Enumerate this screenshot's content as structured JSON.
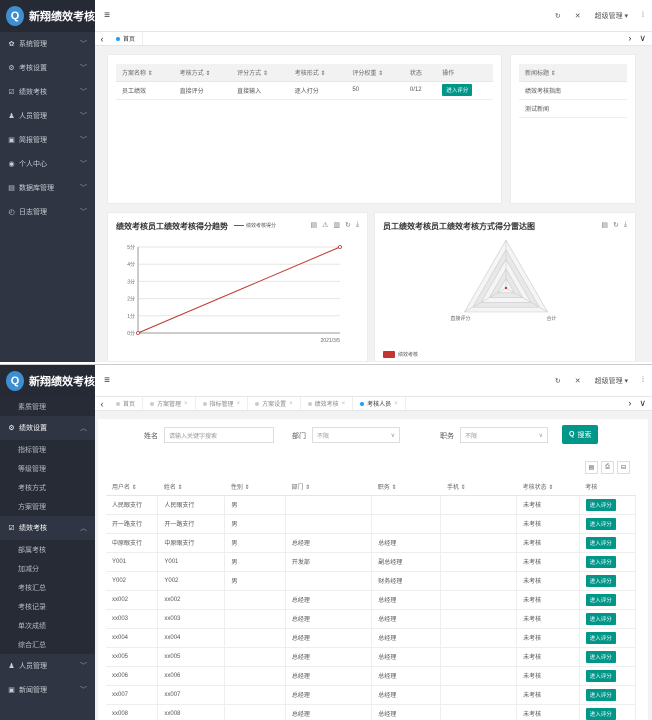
{
  "app": {
    "name": "新翔绩效考核",
    "logo": "Q"
  },
  "topbar": {
    "menu_icon": "≡",
    "refresh_icon": "↻",
    "fullscreen_icon": "✕",
    "user": "超级管理",
    "user_caret": "▾",
    "more": "⁞"
  },
  "nav_arrows": {
    "left": "‹",
    "right": "›",
    "down": "∨"
  },
  "shot1": {
    "sidebar": [
      {
        "icon": "✿",
        "label": "系统管理"
      },
      {
        "icon": "⚙",
        "label": "考核设置"
      },
      {
        "icon": "☑",
        "label": "绩效考核"
      },
      {
        "icon": "♟",
        "label": "人员管理"
      },
      {
        "icon": "▣",
        "label": "简报管理"
      },
      {
        "icon": "◉",
        "label": "个人中心"
      },
      {
        "icon": "▤",
        "label": "数据库管理"
      },
      {
        "icon": "◴",
        "label": "日志管理"
      }
    ],
    "tabs": [
      {
        "label": "首页"
      }
    ],
    "plan_table": {
      "headers": [
        "方案名称",
        "考核方式",
        "评分方式",
        "考核形式",
        "评分权重",
        "状态",
        "操作"
      ],
      "rows": [
        [
          "员工绩效",
          "直接评分",
          "直接输入",
          "逐人打分",
          "50",
          "0/12",
          "进入评分"
        ]
      ]
    },
    "news": {
      "header": "新闻标题",
      "items": [
        "绩效考核指南",
        "测试新闻"
      ]
    },
    "line_chart_title": "绩效考核员工绩效考核得分趋势",
    "line_chart_legend": "绩效考核得分",
    "radar_chart_title": "员工绩效考核员工绩效考核方式得分雷达图",
    "radar_labels": [
      "直接评分",
      "合计"
    ],
    "radar_legend": "绩效考核",
    "chart_tools": [
      "▤",
      "⚠",
      "▥",
      "↻",
      "⤓"
    ],
    "chart_tools2": [
      "▤",
      "↻",
      "⤓"
    ]
  },
  "chart_data": [
    {
      "type": "line",
      "title": "绩效考核员工绩效考核得分趋势",
      "x": [
        "",
        "2021/3/5"
      ],
      "series": [
        {
          "name": "绩效考核得分",
          "values": [
            0,
            5
          ]
        }
      ],
      "yticks": [
        "0分",
        "1分",
        "2分",
        "3分",
        "4分",
        "5分"
      ],
      "ylim": [
        0,
        5
      ],
      "color": "#c23531"
    },
    {
      "type": "radar",
      "title": "员工绩效考核员工绩效考核方式得分雷达图",
      "indicators": [
        "直接评分",
        "合计"
      ],
      "series": [
        {
          "name": "绩效考核",
          "values": [
            0,
            0
          ]
        }
      ],
      "color": "#c23531"
    }
  ],
  "shot2": {
    "sidebar": {
      "top_item": "素质管理",
      "group1": {
        "icon": "⚙",
        "label": "绩效设置",
        "items": [
          "指标管理",
          "等级管理",
          "考核方式",
          "方案管理"
        ]
      },
      "group2": {
        "icon": "☑",
        "label": "绩效考核",
        "items": [
          "部属考核",
          "加减分",
          "考核汇总",
          "考核记录",
          "单次成绩",
          "综合汇总"
        ]
      },
      "group3": {
        "icon": "♟",
        "label": "人员管理"
      },
      "group4": {
        "icon": "▣",
        "label": "新闻管理"
      }
    },
    "tabs": [
      {
        "label": "首页",
        "active": false
      },
      {
        "label": "方案管理",
        "active": false
      },
      {
        "label": "指标管理",
        "active": false
      },
      {
        "label": "方案设置",
        "active": false
      },
      {
        "label": "绩效考核",
        "active": false
      },
      {
        "label": "考核人员",
        "active": true
      }
    ],
    "form": {
      "name_label": "姓名",
      "name_placeholder": "请输入关键字搜索",
      "dept_label": "部门",
      "dept_value": "不限",
      "pos_label": "职务",
      "pos_value": "不限",
      "search_label": "搜索",
      "search_icon": "Q"
    },
    "toolbar": [
      "▤",
      "⎙",
      "⊟"
    ],
    "people_table": {
      "headers": [
        "用户名",
        "姓名",
        "性别",
        "部门",
        "职务",
        "手机",
        "考核状态",
        "考核"
      ],
      "rows": [
        [
          "人民眼支行",
          "人民眼支行",
          "男",
          "",
          "",
          "",
          "未考核",
          "进入评分"
        ],
        [
          "开一路支行",
          "开一路支行",
          "男",
          "",
          "",
          "",
          "未考核",
          "进入评分"
        ],
        [
          "中原眼支行",
          "中原眼支行",
          "男",
          "总经理",
          "总经理",
          "",
          "未考核",
          "进入评分"
        ],
        [
          "Y001",
          "Y001",
          "男",
          "开发部",
          "副总经理",
          "",
          "未考核",
          "进入评分"
        ],
        [
          "Y002",
          "Y002",
          "男",
          "",
          "财务经理",
          "",
          "未考核",
          "进入评分"
        ],
        [
          "xx002",
          "xx002",
          "",
          "总经理",
          "总经理",
          "",
          "未考核",
          "进入评分"
        ],
        [
          "xx003",
          "xx003",
          "",
          "总经理",
          "总经理",
          "",
          "未考核",
          "进入评分"
        ],
        [
          "xx004",
          "xx004",
          "",
          "总经理",
          "总经理",
          "",
          "未考核",
          "进入评分"
        ],
        [
          "xx005",
          "xx005",
          "",
          "总经理",
          "总经理",
          "",
          "未考核",
          "进入评分"
        ],
        [
          "xx006",
          "xx006",
          "",
          "总经理",
          "总经理",
          "",
          "未考核",
          "进入评分"
        ],
        [
          "xx007",
          "xx007",
          "",
          "总经理",
          "总经理",
          "",
          "未考核",
          "进入评分"
        ],
        [
          "xx008",
          "xx008",
          "",
          "总经理",
          "总经理",
          "",
          "未考核",
          "进入评分"
        ]
      ]
    }
  }
}
